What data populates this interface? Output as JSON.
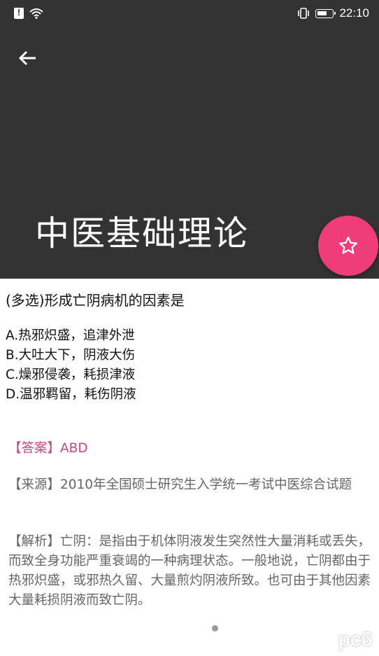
{
  "status_bar": {
    "time": "22:10",
    "left_icons": [
      "alert-icon",
      "wifi-icon"
    ],
    "right_icons": [
      "vibrate-icon",
      "battery-icon"
    ]
  },
  "header": {
    "title": "中医基础理论",
    "background_color": "#333333",
    "back_icon": "arrow-left-icon",
    "fab_icon": "star-outline-icon",
    "fab_color": "#ee3d78"
  },
  "question": {
    "text": "(多选)形成亡阴病机的因素是",
    "options": [
      "A.热邪炽盛，追津外泄",
      "B.大吐大下，阴液大伤",
      "C.燥邪侵袭，耗损津液",
      "D.温邪羁留，耗伤阴液"
    ]
  },
  "answer": {
    "text": "【答案】ABD",
    "color": "#c24a82"
  },
  "source": {
    "text": "【来源】2010年全国硕士研究生入学统一考试中医综合试题"
  },
  "analysis": {
    "text": "【解析】亡阴：是指由于机体阴液发生突然性大量消耗或丢失，而致全身功能严重衰竭的一种病理状态。一般地说，亡阴都由于热邪炽盛，或邪热久留、大量煎灼阴液所致。也可由于其他因素大量耗损阴液而致亡阴。"
  },
  "watermark": "pc6"
}
